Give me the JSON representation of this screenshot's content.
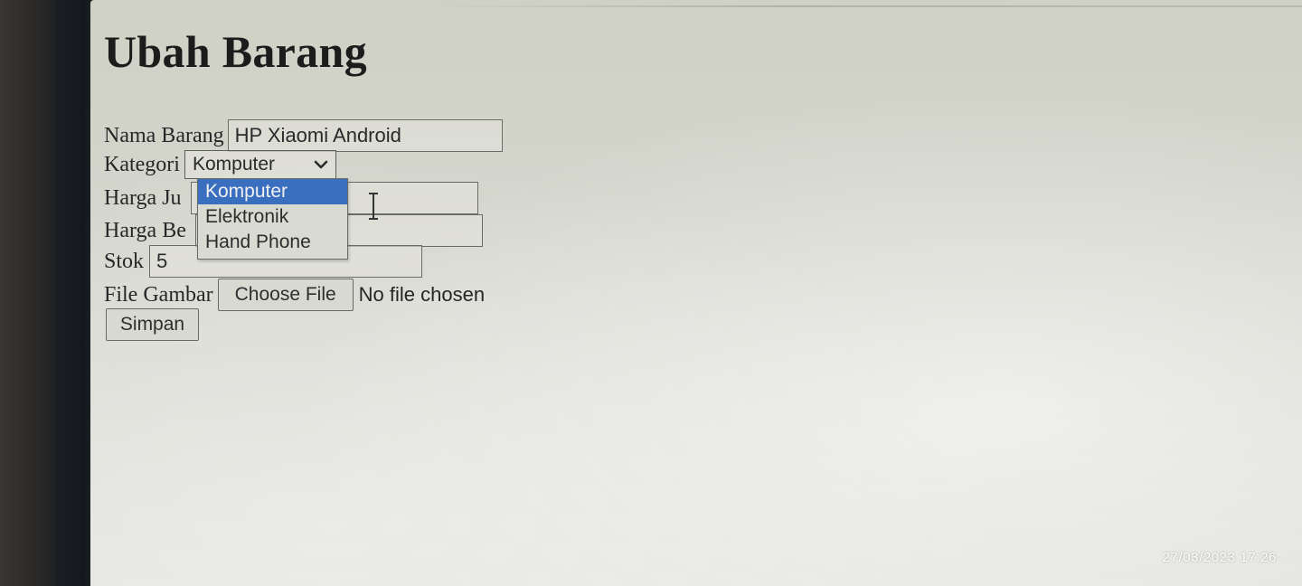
{
  "page": {
    "title": "Ubah Barang"
  },
  "form": {
    "nama_barang": {
      "label": "Nama Barang",
      "value": "HP Xiaomi Android"
    },
    "kategori": {
      "label": "Kategori",
      "selected": "Komputer",
      "options": [
        "Komputer",
        "Elektronik",
        "Hand Phone"
      ]
    },
    "harga_jual": {
      "label_visible": "Harga Ju",
      "value": ""
    },
    "harga_beli": {
      "label_visible": "Harga Be",
      "value": ""
    },
    "stok": {
      "label": "Stok",
      "value": "5"
    },
    "file_gambar": {
      "label": "File Gambar",
      "button_label": "Choose File",
      "status": "No file chosen"
    },
    "submit_label": "Simpan"
  },
  "photo": {
    "timestamp": "27/03/2023 17:26"
  },
  "colors": {
    "selected_option_bg": "#3a6fbf",
    "text": "#272727"
  },
  "icons": {
    "dropdown_arrow": "chevron-down-icon",
    "cursor": "text-cursor-icon"
  }
}
